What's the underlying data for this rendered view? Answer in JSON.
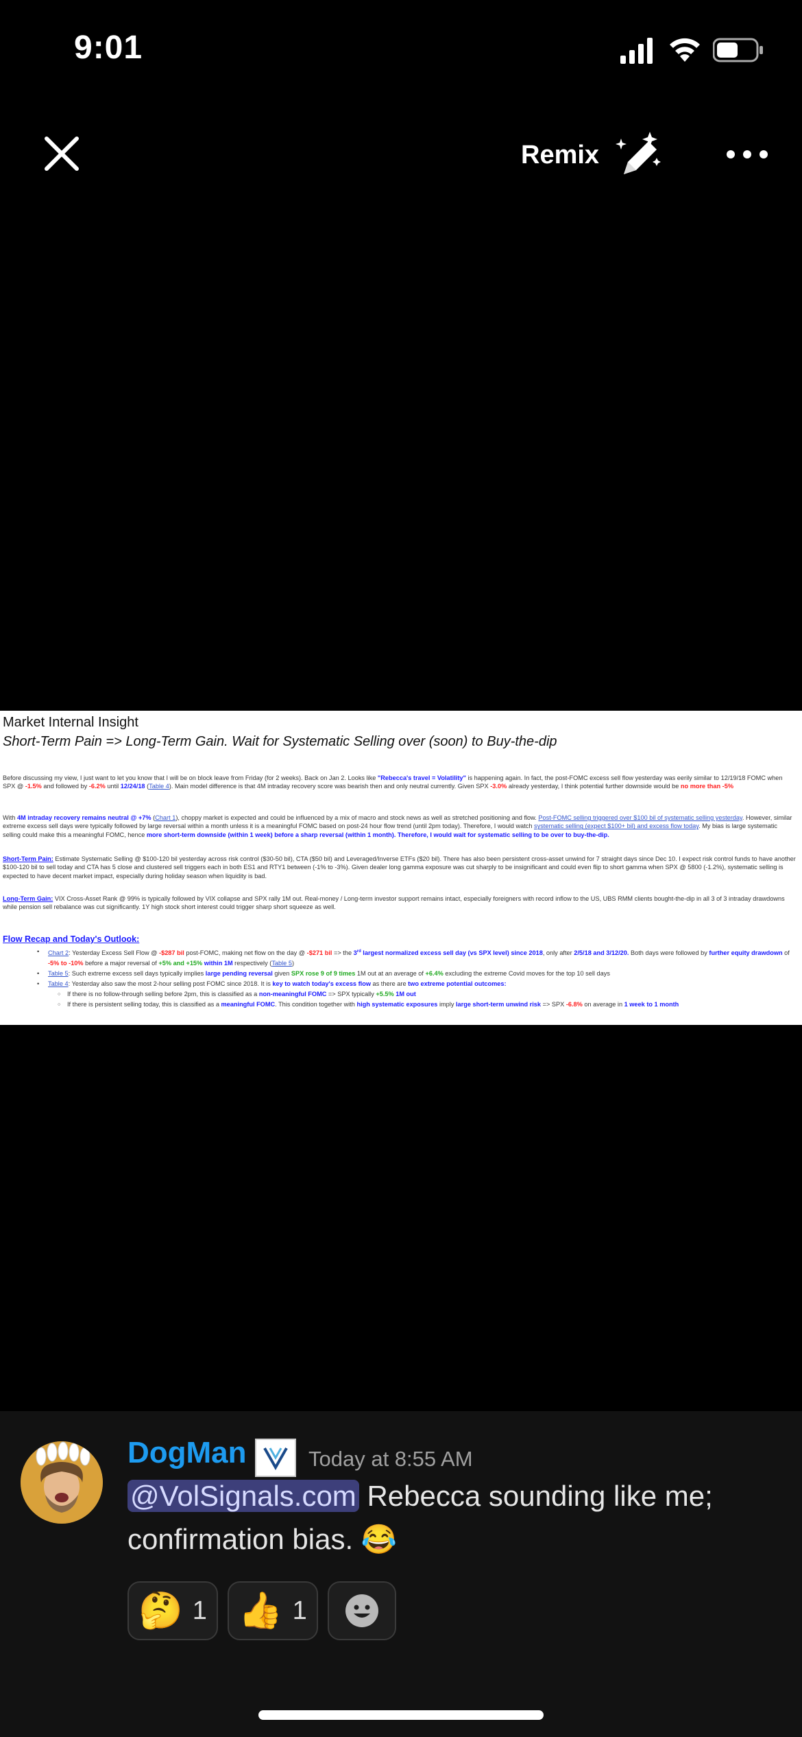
{
  "status_bar": {
    "time": "9:01"
  },
  "topbar": {
    "remix_label": "Remix"
  },
  "document": {
    "title1": "Market Internal Insight",
    "title2": "Short-Term Pain => Long-Term Gain.  Wait for Systematic Selling over (soon) to Buy-the-dip",
    "p1": {
      "a": "Before discussing my view, I just want to let you know that I will be on block leave from Friday (for 2 weeks).  Back on Jan 2.  Looks like ",
      "b": "\"Rebecca's travel = Volatility\"",
      "c": " is happening again.  In fact, the post-FOMC excess sell flow yesterday was eerily similar to 12/19/18 FOMC when SPX @ ",
      "d": "-1.5%",
      "e": " and followed by ",
      "f": "-6.2%",
      "g": " until ",
      "h": "12/24/18",
      "i": " (",
      "j": "Table 4",
      "k": ").  Main model difference is that 4M intraday recovery score was bearish then and only neutral currently.  Given SPX ",
      "l": "-3.0%",
      "m": " already yesterday, I think potential further downside would be ",
      "n": "no more than -5%"
    },
    "p2": {
      "a": "With ",
      "b": "4M intraday recovery remains neutral @ +7%",
      "c": " (",
      "d": "Chart 1",
      "e": "), choppy market is expected and could be influenced by a mix of macro and stock news as well as stretched positioning and flow.  ",
      "f": "Post-FOMC selling triggered over $100 bil of systematic selling yesterday",
      "g": ". However, similar extreme excess sell days were typically followed by large reversal within a month unless it is a meaningful FOMC based on post-24 hour flow trend (until 2pm today).  Therefore, I would watch ",
      "h": "systematic selling (expect $100+ bil) and excess flow today",
      "i": ".  My bias is large systematic selling could make this a meaningful FOMC, hence ",
      "j": "more short-term downside (within 1 week) before a sharp reversal (within 1 month).  Therefore, I would wait for systematic selling to be over to buy-the-dip."
    },
    "p3": {
      "label": "Short-Term Pain:",
      "text": " Estimate Systematic Selling @ $100-120 bil yesterday across risk control ($30-50 bil), CTA ($50 bil) and Leveraged/Inverse ETFs ($20 bil).  There has also been persistent cross-asset unwind for 7 straight days since Dec 10. I expect risk control funds to have another $100-120 bil to sell today and CTA has 5 close and clustered sell triggers each in both ES1 and RTY1 between (-1% to -3%).  Given dealer long gamma exposure was cut sharply to be insignificant and could even flip to short gamma when SPX @ 5800 (-1.2%), systematic selling is expected to have decent market impact, especially during holiday season when liquidity is bad."
    },
    "p4": {
      "label": "Long-Term Gain:",
      "text": " VIX Cross-Asset Rank @ 99% is typically followed by VIX collapse and SPX rally 1M out. Real-money / Long-term investor support remains intact, especially foreigners with record inflow to the US, UBS RMM clients bought-the-dip in all 3 of 3 intraday drawdowns while pension sell rebalance was cut significantly.  1Y high stock short interest could trigger sharp short squeeze as well."
    },
    "heading": "Flow Recap and Today's Outlook:",
    "bullets": {
      "b1": {
        "link": "Chart 2",
        "a": ": Yesterday Excess Sell Flow @ ",
        "b": "-$287 bil",
        "c": " post-FOMC, making net flow on the day @ ",
        "d": "-$271 bil",
        "e": " => the ",
        "f": "3",
        "g": "rd",
        "h": " largest normalized excess sell day (vs SPX level) since 2018",
        "i": ", only after ",
        "j": "2/5/18 and 3/12/20.",
        "k": "  Both days were followed by ",
        "l": "further equity drawdown",
        "m": " of ",
        "n": "-5% to -10%",
        "o": " before a major reversal of ",
        "p": "+5% and +15%",
        "q": " within 1M",
        "r": " respectively (",
        "s": "Table 5",
        "t": ")"
      },
      "b2": {
        "link": "Table 5",
        "a": ": Such extreme excess sell days typically implies ",
        "b": "large pending reversal",
        "c": " given ",
        "d": "SPX rose 9 of 9 times",
        "e": " 1M out at an average of ",
        "f": "+6.4%",
        "g": " excluding the extreme Covid moves for the top 10 sell days"
      },
      "b3": {
        "link": "Table 4",
        "a": ": Yesterday also saw the most 2-hour selling post FOMC since 2018.  It is ",
        "b": "key to watch today's excess flow",
        "c": " as there are ",
        "d": "two extreme potential outcomes:"
      },
      "s1": {
        "a": "If there is no follow-through selling before 2pm, this is classified as a ",
        "b": "non-meaningful FOMC",
        "c": " => SPX typically ",
        "d": "+5.5%",
        "e": " 1M out"
      },
      "s2": {
        "a": "If there is persistent selling today, this is classified as a ",
        "b": "meaningful FOMC",
        "c": ".  This condition together with ",
        "d": "high systematic exposures",
        "e": " imply ",
        "f": "large short-term unwind risk",
        "g": " => SPX ",
        "h": "-6.8%",
        "i": " on average in ",
        "j": "1 week to 1 month"
      }
    }
  },
  "message": {
    "username": "DogMan",
    "timestamp": "Today at 8:55 AM",
    "mention": "@VolSignals.com",
    "text_line": " Rebecca sounding like me; confirmation bias. ",
    "text_emoji": "😂",
    "reactions": [
      {
        "emoji": "🤔",
        "count": "1"
      },
      {
        "emoji": "👍",
        "count": "1"
      }
    ]
  },
  "colors": {
    "username": "#1d9bf0",
    "mention_bg": "#3d3f7a",
    "chat_bg": "#121212"
  }
}
